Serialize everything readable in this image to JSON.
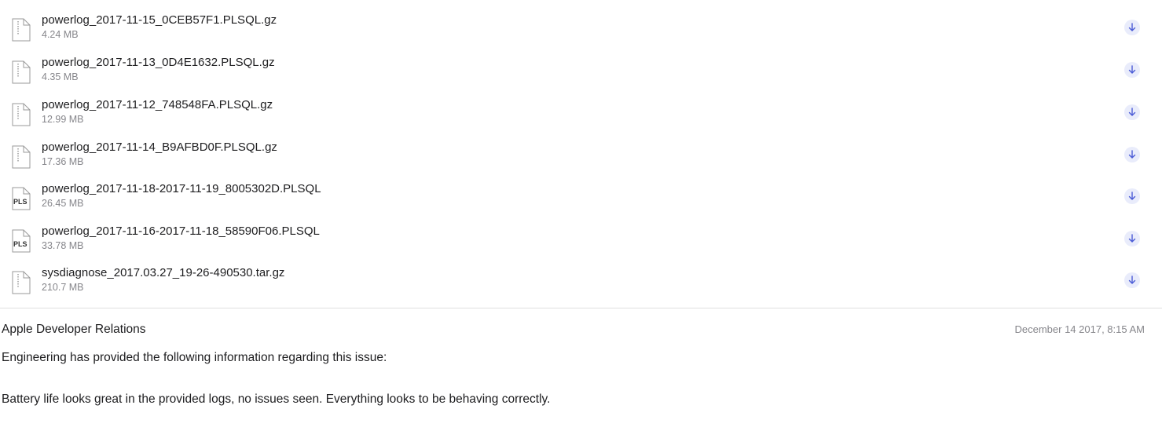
{
  "attachments": [
    {
      "name": "powerlog_2017-11-15_0CEB57F1.PLSQL.gz",
      "size": "4.24 MB",
      "icon": "zip-file-icon"
    },
    {
      "name": "powerlog_2017-11-13_0D4E1632.PLSQL.gz",
      "size": "4.35 MB",
      "icon": "zip-file-icon"
    },
    {
      "name": "powerlog_2017-11-12_748548FA.PLSQL.gz",
      "size": "12.99 MB",
      "icon": "zip-file-icon"
    },
    {
      "name": "powerlog_2017-11-14_B9AFBD0F.PLSQL.gz",
      "size": "17.36 MB",
      "icon": "zip-file-icon"
    },
    {
      "name": "powerlog_2017-11-18-2017-11-19_8005302D.PLSQL",
      "size": "26.45 MB",
      "icon": "pls-file-icon",
      "badge": "PLS"
    },
    {
      "name": "powerlog_2017-11-16-2017-11-18_58590F06.PLSQL",
      "size": "33.78 MB",
      "icon": "pls-file-icon",
      "badge": "PLS"
    },
    {
      "name": "sysdiagnose_2017.03.27_19-26-490530.tar.gz",
      "size": "210.7 MB",
      "icon": "zip-file-icon"
    }
  ],
  "comment": {
    "author": "Apple Developer Relations",
    "timestamp": "December 14 2017, 8:15 AM",
    "line1": "Engineering has provided the following information regarding this issue:",
    "line2": "Battery life looks great in the provided logs, no issues seen. Everything looks to be behaving correctly."
  },
  "colors": {
    "accent": "#4a5bd6",
    "download_bg": "#e9ecfb",
    "secondary_text": "#86868b",
    "divider": "#e0e0e0"
  }
}
